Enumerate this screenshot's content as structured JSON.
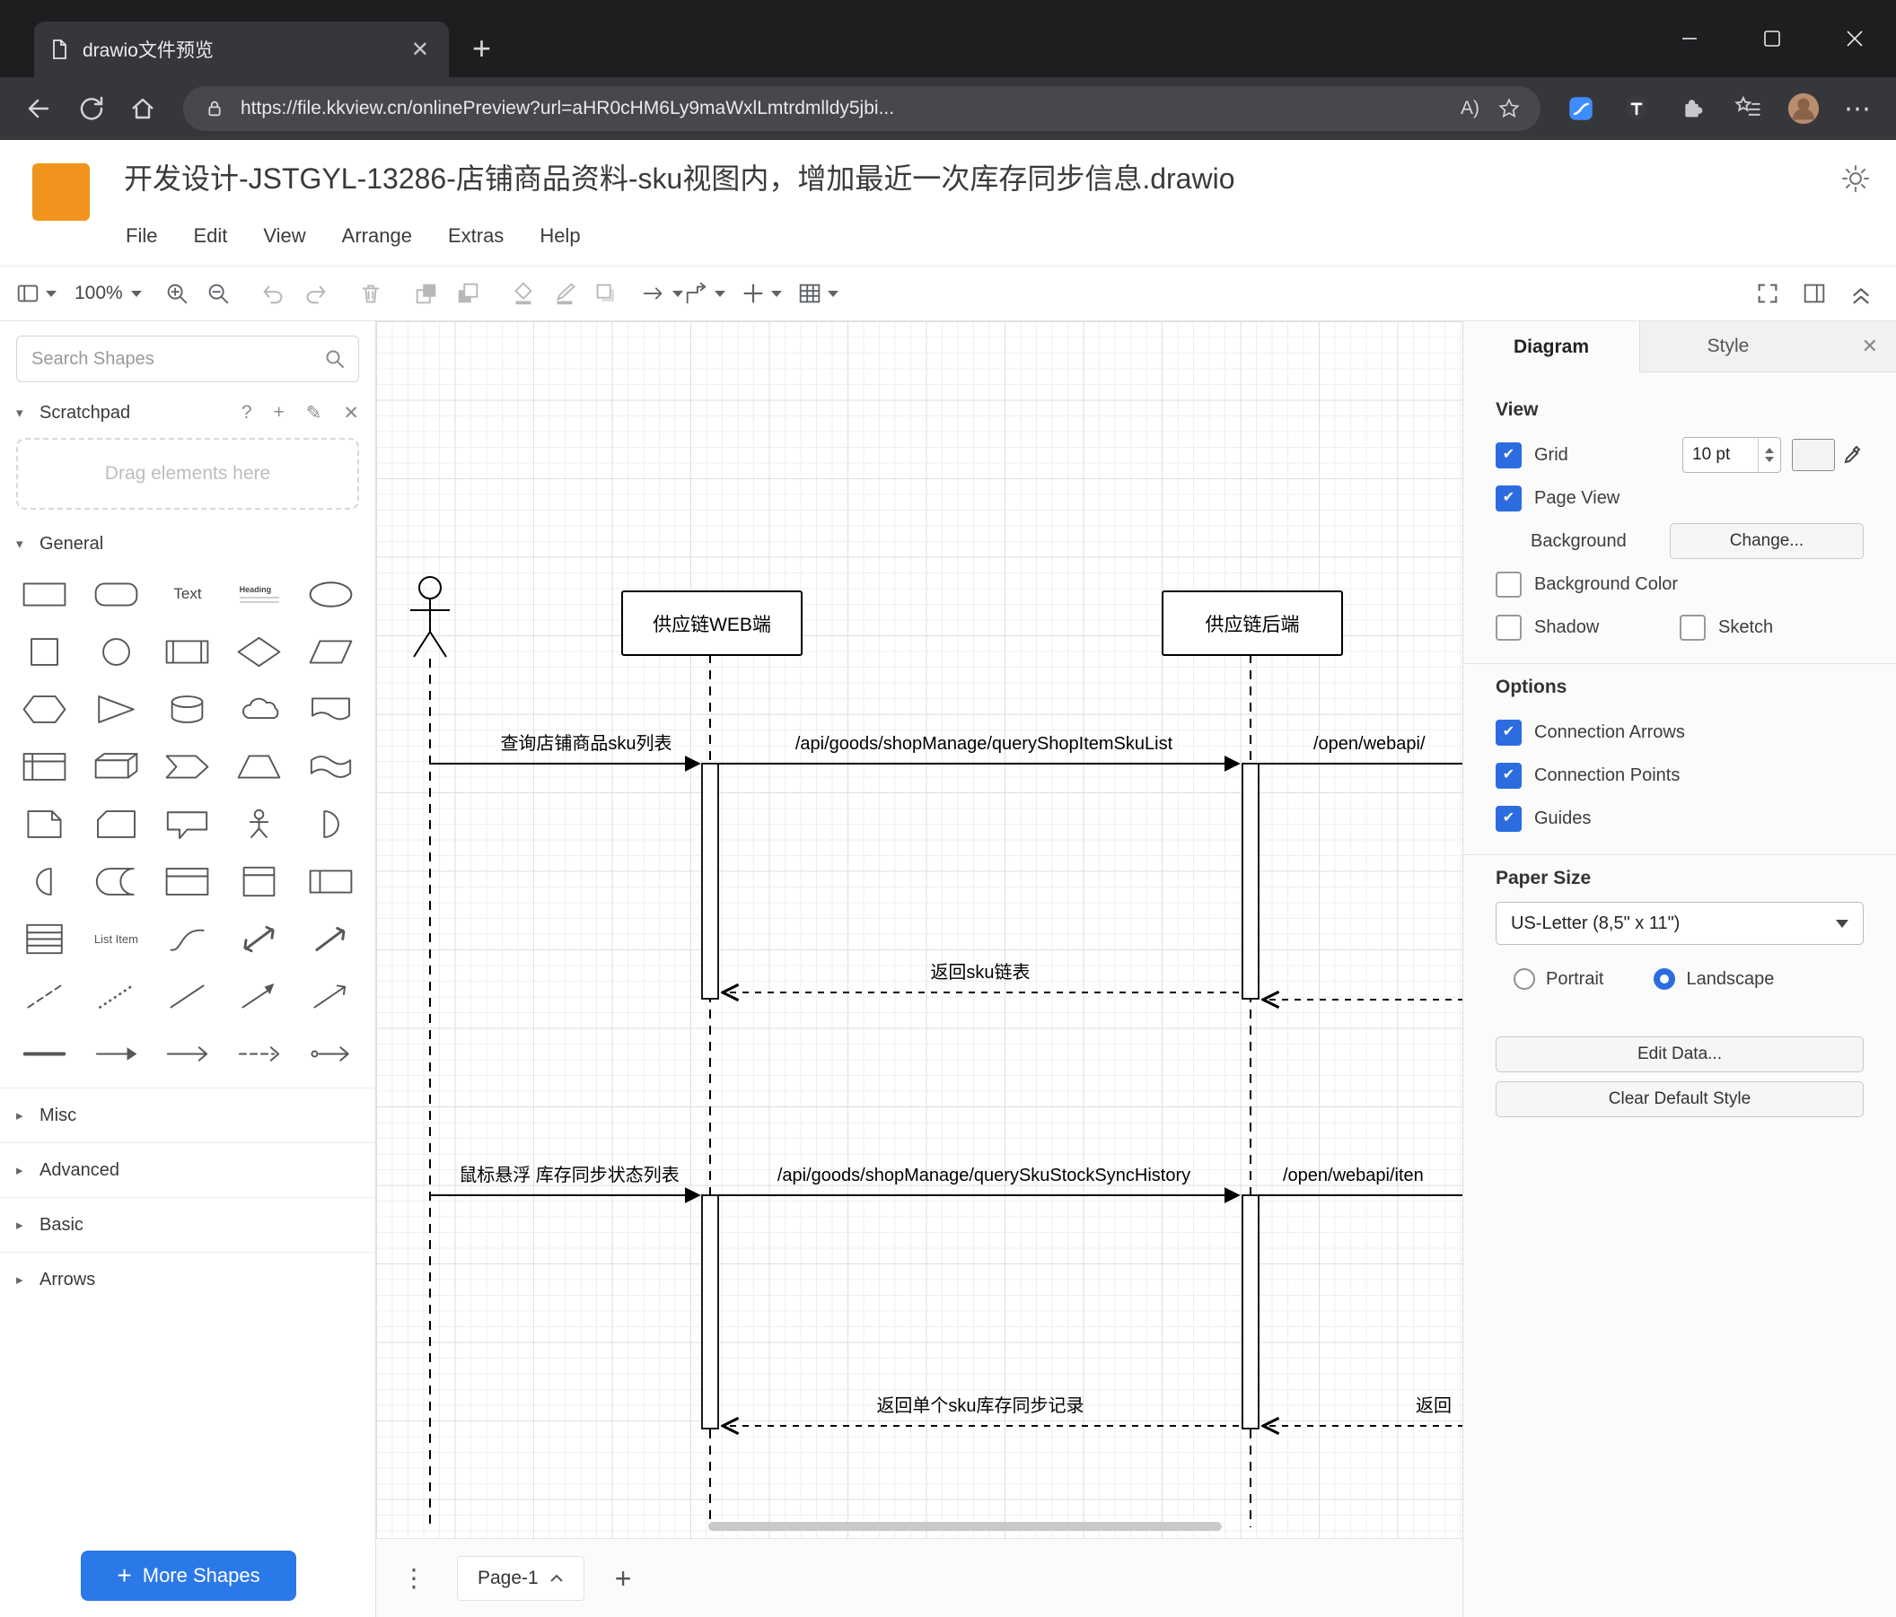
{
  "browser": {
    "tab": {
      "title": "drawio文件预览"
    },
    "address": {
      "url": "https://file.kkview.cn/onlinePreview?url=aHR0cHM6Ly9maWxlLmtrdmlldy5jbi...",
      "reader_label": "A)"
    }
  },
  "app": {
    "doc_title": "开发设计-JSTGYL-13286-店铺商品资料-sku视图内，增加最近一次库存同步信息.drawio",
    "menus": [
      "File",
      "Edit",
      "View",
      "Arrange",
      "Extras",
      "Help"
    ],
    "toolbar": {
      "zoom_level": "100%"
    }
  },
  "sidebar": {
    "search_placeholder": "Search Shapes",
    "scratchpad_title": "Scratchpad",
    "scratchpad_hint": "Drag elements here",
    "general_title": "General",
    "collapsed_sections": [
      "Misc",
      "Advanced",
      "Basic",
      "Arrows"
    ],
    "shape_labels": {
      "text": "Text",
      "heading": "Heading",
      "list_item": "List Item"
    },
    "shapes": [
      "rectangle",
      "rounded-rectangle",
      "text",
      "heading",
      "ellipse",
      "square",
      "circle",
      "process",
      "diamond",
      "parallelogram",
      "hexagon",
      "triangle",
      "cylinder",
      "cloud",
      "document",
      "internal-storage",
      "cube",
      "step",
      "trapezoid",
      "tape",
      "note",
      "card",
      "callout",
      "actor",
      "or",
      "and",
      "data-storage",
      "container",
      "vertical-container",
      "horizontal-container",
      "list",
      "list-item",
      "curve",
      "bidirectional-arrow",
      "arrow",
      "dashed-line",
      "dotted-line",
      "line",
      "diagonal-arrow",
      "diagonal-arrow-2",
      "horizontal-line",
      "horizontal-arrow",
      "horizontal-arrow-2",
      "horizontal-arrow-dashed",
      "horizontal-connector"
    ],
    "more_shapes_label": "More Shapes"
  },
  "canvas": {
    "actors": {
      "web": "供应链WEB端",
      "backend": "供应链后端"
    },
    "messages": {
      "query_sku_list": "查询店铺商品sku列表",
      "api_query_shop_item_sku_list": "/api/goods/shopManage/queryShopItemSkuList",
      "open_webapi_1": "/open/webapi/",
      "return_sku_list": "返回sku链表",
      "hover_stock_sync": "鼠标悬浮 库存同步状态列表",
      "api_query_sku_stock_sync_history": "/api/goods/shopManage/querySkuStockSyncHistory",
      "open_webapi_2": "/open/webapi/iten",
      "return_single_sku": "返回单个sku库存同步记录",
      "return_right": "返回"
    }
  },
  "pages": {
    "current": "Page-1"
  },
  "panel": {
    "tabs": {
      "diagram": "Diagram",
      "style": "Style"
    },
    "view": {
      "heading": "View",
      "grid": "Grid",
      "grid_checked": true,
      "grid_size": "10 pt",
      "page_view": "Page View",
      "page_view_checked": true,
      "background": "Background",
      "change_button": "Change...",
      "background_color": "Background Color",
      "background_color_checked": false,
      "shadow": "Shadow",
      "shadow_checked": false,
      "sketch": "Sketch",
      "sketch_checked": false
    },
    "options": {
      "heading": "Options",
      "connection_arrows": "Connection Arrows",
      "connection_arrows_checked": true,
      "connection_points": "Connection Points",
      "connection_points_checked": true,
      "guides": "Guides",
      "guides_checked": true
    },
    "paper": {
      "heading": "Paper Size",
      "size_value": "US-Letter (8,5\" x 11\")",
      "portrait": "Portrait",
      "landscape": "Landscape",
      "orientation": "landscape"
    },
    "buttons": {
      "edit_data": "Edit Data...",
      "clear_default_style": "Clear Default Style"
    }
  },
  "colors": {
    "accent": "#2b6de0",
    "more-blue": "#2b78e8",
    "logo-orange": "#f2931e"
  }
}
